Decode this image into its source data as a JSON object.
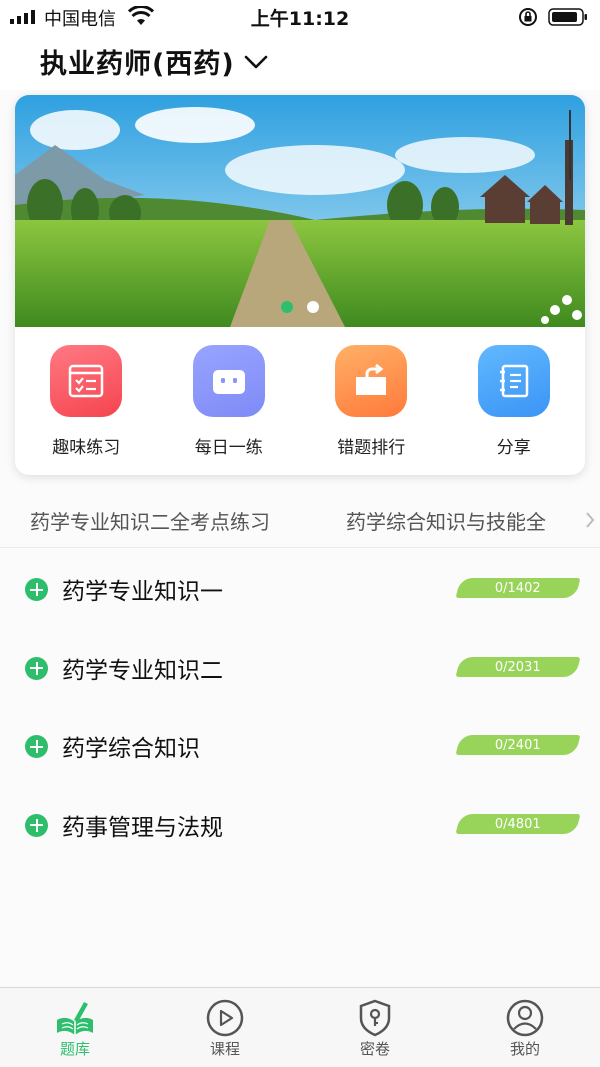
{
  "status_bar": {
    "carrier": "中国电信",
    "time": "上午11:12"
  },
  "header": {
    "title": "执业药师(西药)",
    "chevron_icon": "chevron-down-icon"
  },
  "banner": {
    "slides": 2,
    "active_slide": 1
  },
  "shortcuts": [
    {
      "label": "趣味练习",
      "icon": "practice-list-icon",
      "color": "#f5444f"
    },
    {
      "label": "每日一练",
      "icon": "robot-face-icon",
      "color": "#7f8bf6"
    },
    {
      "label": "错题排行",
      "icon": "folder-share-icon",
      "color": "#ff7a3a"
    },
    {
      "label": "分享",
      "icon": "notebook-icon",
      "color": "#3a95f5"
    }
  ],
  "subject_tabs": [
    {
      "label": "药学专业知识二全考点练习"
    },
    {
      "label": "药学综合知识与技能全"
    }
  ],
  "subjects": [
    {
      "name": "药学专业知识一",
      "progress": "0/1402"
    },
    {
      "name": "药学专业知识二",
      "progress": "0/2031"
    },
    {
      "name": "药学综合知识",
      "progress": "0/2401"
    },
    {
      "name": "药事管理与法规",
      "progress": "0/4801"
    }
  ],
  "tab_bar": [
    {
      "label": "题库",
      "icon": "book-pen-icon",
      "active": true
    },
    {
      "label": "课程",
      "icon": "play-circle-icon",
      "active": false
    },
    {
      "label": "密卷",
      "icon": "shield-key-icon",
      "active": false
    },
    {
      "label": "我的",
      "icon": "user-circle-icon",
      "active": false
    }
  ],
  "colors": {
    "accent_green": "#2dbf6e",
    "progress_badge": "#98d45a"
  }
}
